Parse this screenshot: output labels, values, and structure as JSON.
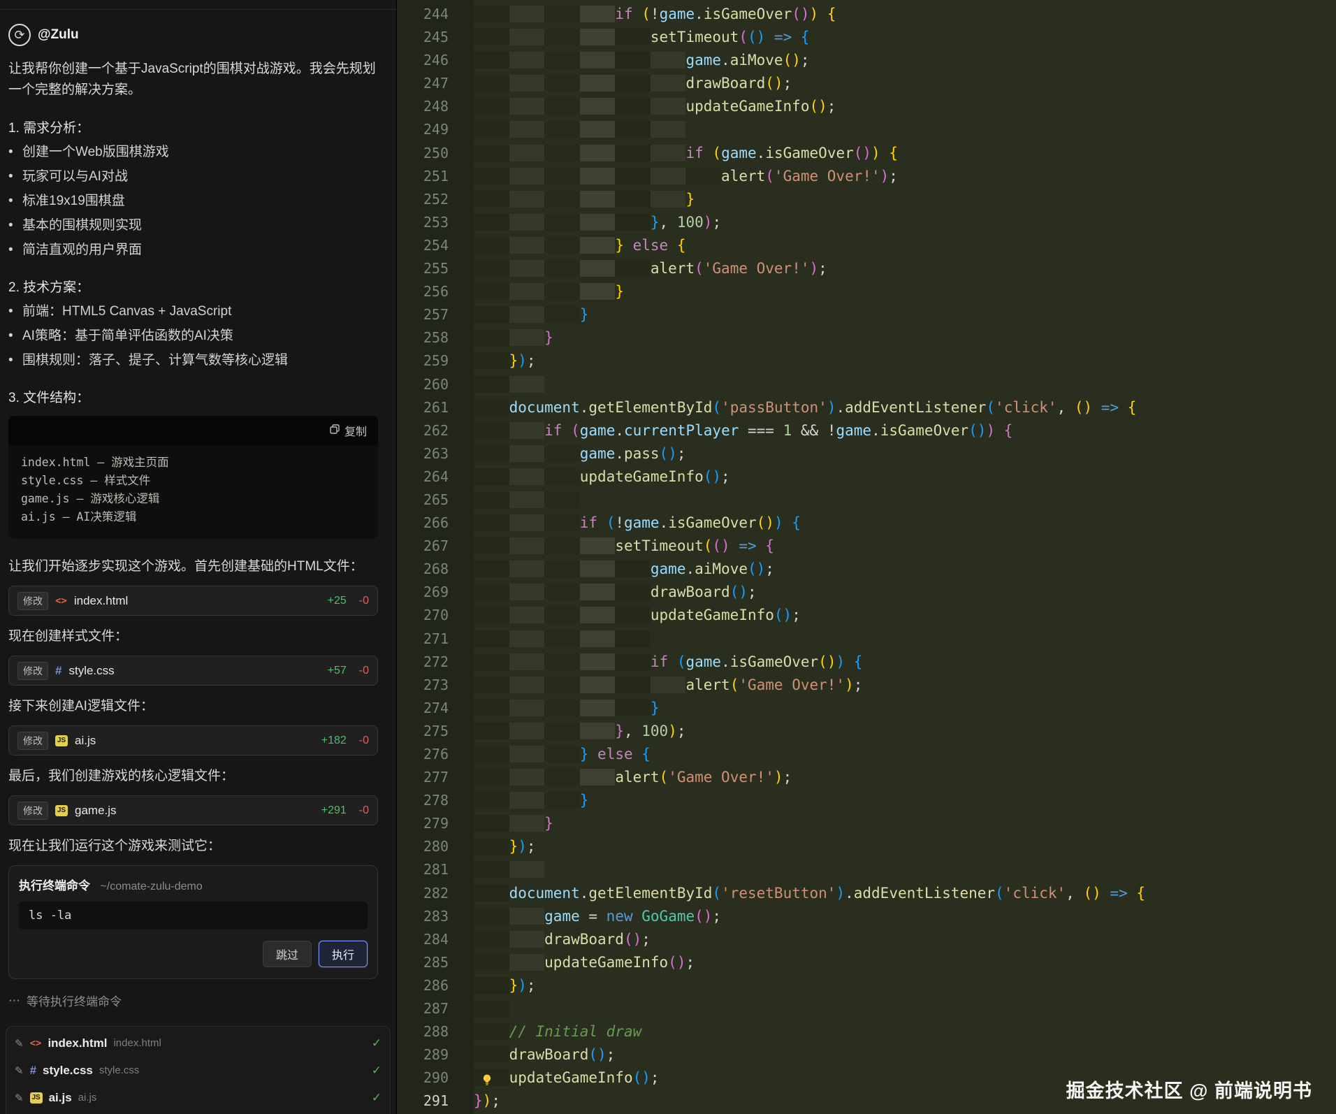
{
  "watermark": "掘金技术社区 @ 前端说明书",
  "assistant": {
    "name": "@Zulu",
    "intro": "让我帮你创建一个基于JavaScript的围棋对战游戏。我会先规划一个完整的解决方案。",
    "sections": [
      {
        "heading": "1. 需求分析：",
        "bullets": [
          "创建一个Web版围棋游戏",
          "玩家可以与AI对战",
          "标准19x19围棋盘",
          "基本的围棋规则实现",
          "简洁直观的用户界面"
        ]
      },
      {
        "heading": "2. 技术方案：",
        "bullets": [
          "前端：HTML5 Canvas + JavaScript",
          "AI策略：基于简单评估函数的AI决策",
          "围棋规则：落子、提子、计算气数等核心逻辑"
        ]
      },
      {
        "heading": "3. 文件结构：",
        "bullets": []
      }
    ],
    "code_block": {
      "copy_label": "复制",
      "lines": [
        "index.html — 游戏主页面",
        "style.css — 样式文件",
        "game.js — 游戏核心逻辑",
        "ai.js — AI决策逻辑"
      ]
    },
    "steps": [
      {
        "text": "让我们开始逐步实现这个游戏。首先创建基础的HTML文件：",
        "card": {
          "badge": "修改",
          "file": "index.html",
          "type": "html",
          "added": "+25",
          "removed": "-0"
        }
      },
      {
        "text": "现在创建样式文件：",
        "card": {
          "badge": "修改",
          "file": "style.css",
          "type": "css",
          "added": "+57",
          "removed": "-0"
        }
      },
      {
        "text": "接下来创建AI逻辑文件：",
        "card": {
          "badge": "修改",
          "file": "ai.js",
          "type": "js",
          "added": "+182",
          "removed": "-0"
        }
      },
      {
        "text": "最后，我们创建游戏的核心逻辑文件：",
        "card": {
          "badge": "修改",
          "file": "game.js",
          "type": "js",
          "added": "+291",
          "removed": "-0"
        }
      },
      {
        "text": "现在让我们运行这个游戏来测试它：",
        "card": null
      }
    ],
    "terminal": {
      "title": "执行终端命令",
      "path": "~/comate-zulu-demo",
      "command": "ls -la",
      "skip_label": "跳过",
      "run_label": "执行"
    },
    "waiting": "等待执行终端命令",
    "files": [
      {
        "name": "index.html",
        "path": "index.html",
        "type": "html"
      },
      {
        "name": "style.css",
        "path": "style.css",
        "type": "css"
      },
      {
        "name": "ai.js",
        "path": "ai.js",
        "type": "js"
      }
    ]
  },
  "editor": {
    "lines": [
      {
        "n": 244,
        "i": 16,
        "t": [
          [
            "if",
            "k"
          ],
          [
            " ",
            ""
          ],
          [
            "(",
            "b0"
          ],
          [
            "!",
            "o"
          ],
          [
            "game",
            "v"
          ],
          [
            ".",
            "o"
          ],
          [
            "isGameOver",
            "f"
          ],
          [
            "()",
            "b1"
          ],
          [
            ")",
            "b0"
          ],
          [
            " ",
            ""
          ],
          [
            "{",
            "b0"
          ]
        ]
      },
      {
        "n": 245,
        "i": 20,
        "t": [
          [
            "setTimeout",
            "f"
          ],
          [
            "(",
            "b1"
          ],
          [
            "()",
            "b2"
          ],
          [
            " => ",
            "a"
          ],
          [
            "{",
            "b2"
          ]
        ]
      },
      {
        "n": 246,
        "i": 24,
        "t": [
          [
            "game",
            "v"
          ],
          [
            ".",
            "o"
          ],
          [
            "aiMove",
            "f"
          ],
          [
            "()",
            "b0"
          ],
          [
            ";",
            "o"
          ]
        ]
      },
      {
        "n": 247,
        "i": 24,
        "t": [
          [
            "drawBoard",
            "f"
          ],
          [
            "()",
            "b0"
          ],
          [
            ";",
            "o"
          ]
        ]
      },
      {
        "n": 248,
        "i": 24,
        "t": [
          [
            "updateGameInfo",
            "f"
          ],
          [
            "()",
            "b0"
          ],
          [
            ";",
            "o"
          ]
        ]
      },
      {
        "n": 249,
        "i": 24,
        "t": []
      },
      {
        "n": 250,
        "i": 24,
        "t": [
          [
            "if",
            "k"
          ],
          [
            " ",
            ""
          ],
          [
            "(",
            "b0"
          ],
          [
            "game",
            "v"
          ],
          [
            ".",
            "o"
          ],
          [
            "isGameOver",
            "f"
          ],
          [
            "()",
            "b1"
          ],
          [
            ")",
            "b0"
          ],
          [
            " ",
            ""
          ],
          [
            "{",
            "b0"
          ]
        ]
      },
      {
        "n": 251,
        "i": 28,
        "t": [
          [
            "alert",
            "f"
          ],
          [
            "(",
            "b1"
          ],
          [
            "'Game Over!'",
            "s"
          ],
          [
            ")",
            "b1"
          ],
          [
            ";",
            "o"
          ]
        ]
      },
      {
        "n": 252,
        "i": 24,
        "t": [
          [
            "}",
            "b0"
          ]
        ]
      },
      {
        "n": 253,
        "i": 20,
        "t": [
          [
            "}",
            "b2"
          ],
          [
            ", ",
            "o"
          ],
          [
            "100",
            "n"
          ],
          [
            ")",
            "b1"
          ],
          [
            ";",
            "o"
          ]
        ]
      },
      {
        "n": 254,
        "i": 16,
        "t": [
          [
            "}",
            "b0"
          ],
          [
            " ",
            ""
          ],
          [
            "else",
            "k"
          ],
          [
            " ",
            ""
          ],
          [
            "{",
            "b0"
          ]
        ]
      },
      {
        "n": 255,
        "i": 20,
        "t": [
          [
            "alert",
            "f"
          ],
          [
            "(",
            "b1"
          ],
          [
            "'Game Over!'",
            "s"
          ],
          [
            ")",
            "b1"
          ],
          [
            ";",
            "o"
          ]
        ]
      },
      {
        "n": 256,
        "i": 16,
        "t": [
          [
            "}",
            "b0"
          ]
        ]
      },
      {
        "n": 257,
        "i": 12,
        "t": [
          [
            "}",
            "b2"
          ]
        ]
      },
      {
        "n": 258,
        "i": 8,
        "t": [
          [
            "}",
            "b1"
          ]
        ]
      },
      {
        "n": 259,
        "i": 4,
        "t": [
          [
            "}",
            "b0"
          ],
          [
            ")",
            "b2"
          ],
          [
            ";",
            "o"
          ]
        ]
      },
      {
        "n": 260,
        "i": 8,
        "t": []
      },
      {
        "n": 261,
        "i": 4,
        "t": [
          [
            "document",
            "v"
          ],
          [
            ".",
            "o"
          ],
          [
            "getElementById",
            "f"
          ],
          [
            "(",
            "b2"
          ],
          [
            "'passButton'",
            "s"
          ],
          [
            ")",
            "b2"
          ],
          [
            ".",
            "o"
          ],
          [
            "addEventListener",
            "f"
          ],
          [
            "(",
            "b2"
          ],
          [
            "'click'",
            "s"
          ],
          [
            ", ",
            "o"
          ],
          [
            "()",
            "b0"
          ],
          [
            " => ",
            "a"
          ],
          [
            "{",
            "b0"
          ]
        ]
      },
      {
        "n": 262,
        "i": 8,
        "t": [
          [
            "if",
            "k"
          ],
          [
            " ",
            ""
          ],
          [
            "(",
            "b1"
          ],
          [
            "game",
            "v"
          ],
          [
            ".",
            "o"
          ],
          [
            "currentPlayer",
            "v"
          ],
          [
            " === ",
            "o"
          ],
          [
            "1",
            "n"
          ],
          [
            " && ",
            "o"
          ],
          [
            "!",
            "o"
          ],
          [
            "game",
            "v"
          ],
          [
            ".",
            "o"
          ],
          [
            "isGameOver",
            "f"
          ],
          [
            "()",
            "b2"
          ],
          [
            ")",
            "b1"
          ],
          [
            " ",
            ""
          ],
          [
            "{",
            "b1"
          ]
        ]
      },
      {
        "n": 263,
        "i": 12,
        "t": [
          [
            "game",
            "v"
          ],
          [
            ".",
            "o"
          ],
          [
            "pass",
            "f"
          ],
          [
            "()",
            "b2"
          ],
          [
            ";",
            "o"
          ]
        ]
      },
      {
        "n": 264,
        "i": 12,
        "t": [
          [
            "updateGameInfo",
            "f"
          ],
          [
            "()",
            "b2"
          ],
          [
            ";",
            "o"
          ]
        ]
      },
      {
        "n": 265,
        "i": 12,
        "t": []
      },
      {
        "n": 266,
        "i": 12,
        "t": [
          [
            "if",
            "k"
          ],
          [
            " ",
            ""
          ],
          [
            "(",
            "b2"
          ],
          [
            "!",
            "o"
          ],
          [
            "game",
            "v"
          ],
          [
            ".",
            "o"
          ],
          [
            "isGameOver",
            "f"
          ],
          [
            "()",
            "b0"
          ],
          [
            ")",
            "b2"
          ],
          [
            " ",
            ""
          ],
          [
            "{",
            "b2"
          ]
        ]
      },
      {
        "n": 267,
        "i": 16,
        "t": [
          [
            "setTimeout",
            "f"
          ],
          [
            "(",
            "b0"
          ],
          [
            "()",
            "b1"
          ],
          [
            " => ",
            "a"
          ],
          [
            "{",
            "b1"
          ]
        ]
      },
      {
        "n": 268,
        "i": 20,
        "t": [
          [
            "game",
            "v"
          ],
          [
            ".",
            "o"
          ],
          [
            "aiMove",
            "f"
          ],
          [
            "()",
            "b2"
          ],
          [
            ";",
            "o"
          ]
        ]
      },
      {
        "n": 269,
        "i": 20,
        "t": [
          [
            "drawBoard",
            "f"
          ],
          [
            "()",
            "b2"
          ],
          [
            ";",
            "o"
          ]
        ]
      },
      {
        "n": 270,
        "i": 20,
        "t": [
          [
            "updateGameInfo",
            "f"
          ],
          [
            "()",
            "b2"
          ],
          [
            ";",
            "o"
          ]
        ]
      },
      {
        "n": 271,
        "i": 20,
        "t": []
      },
      {
        "n": 272,
        "i": 20,
        "t": [
          [
            "if",
            "k"
          ],
          [
            " ",
            ""
          ],
          [
            "(",
            "b2"
          ],
          [
            "game",
            "v"
          ],
          [
            ".",
            "o"
          ],
          [
            "isGameOver",
            "f"
          ],
          [
            "()",
            "b0"
          ],
          [
            ")",
            "b2"
          ],
          [
            " ",
            ""
          ],
          [
            "{",
            "b2"
          ]
        ]
      },
      {
        "n": 273,
        "i": 24,
        "t": [
          [
            "alert",
            "f"
          ],
          [
            "(",
            "b0"
          ],
          [
            "'Game Over!'",
            "s"
          ],
          [
            ")",
            "b0"
          ],
          [
            ";",
            "o"
          ]
        ]
      },
      {
        "n": 274,
        "i": 20,
        "t": [
          [
            "}",
            "b2"
          ]
        ]
      },
      {
        "n": 275,
        "i": 16,
        "t": [
          [
            "}",
            "b1"
          ],
          [
            ", ",
            "o"
          ],
          [
            "100",
            "n"
          ],
          [
            ")",
            "b0"
          ],
          [
            ";",
            "o"
          ]
        ]
      },
      {
        "n": 276,
        "i": 12,
        "t": [
          [
            "}",
            "b2"
          ],
          [
            " ",
            ""
          ],
          [
            "else",
            "k"
          ],
          [
            " ",
            ""
          ],
          [
            "{",
            "b2"
          ]
        ]
      },
      {
        "n": 277,
        "i": 16,
        "t": [
          [
            "alert",
            "f"
          ],
          [
            "(",
            "b0"
          ],
          [
            "'Game Over!'",
            "s"
          ],
          [
            ")",
            "b0"
          ],
          [
            ";",
            "o"
          ]
        ]
      },
      {
        "n": 278,
        "i": 12,
        "t": [
          [
            "}",
            "b2"
          ]
        ]
      },
      {
        "n": 279,
        "i": 8,
        "t": [
          [
            "}",
            "b1"
          ]
        ]
      },
      {
        "n": 280,
        "i": 4,
        "t": [
          [
            "}",
            "b0"
          ],
          [
            ")",
            "b2"
          ],
          [
            ";",
            "o"
          ]
        ]
      },
      {
        "n": 281,
        "i": 8,
        "t": []
      },
      {
        "n": 282,
        "i": 4,
        "t": [
          [
            "document",
            "v"
          ],
          [
            ".",
            "o"
          ],
          [
            "getElementById",
            "f"
          ],
          [
            "(",
            "b2"
          ],
          [
            "'resetButton'",
            "s"
          ],
          [
            ")",
            "b2"
          ],
          [
            ".",
            "o"
          ],
          [
            "addEventListener",
            "f"
          ],
          [
            "(",
            "b2"
          ],
          [
            "'click'",
            "s"
          ],
          [
            ", ",
            "o"
          ],
          [
            "()",
            "b0"
          ],
          [
            " => ",
            "a"
          ],
          [
            "{",
            "b0"
          ]
        ]
      },
      {
        "n": 283,
        "i": 8,
        "t": [
          [
            "game",
            "v"
          ],
          [
            " = ",
            "o"
          ],
          [
            "new",
            "a"
          ],
          [
            " ",
            ""
          ],
          [
            "GoGame",
            "t"
          ],
          [
            "()",
            "b1"
          ],
          [
            ";",
            "o"
          ]
        ]
      },
      {
        "n": 284,
        "i": 8,
        "t": [
          [
            "drawBoard",
            "f"
          ],
          [
            "()",
            "b1"
          ],
          [
            ";",
            "o"
          ]
        ]
      },
      {
        "n": 285,
        "i": 8,
        "t": [
          [
            "updateGameInfo",
            "f"
          ],
          [
            "()",
            "b1"
          ],
          [
            ";",
            "o"
          ]
        ]
      },
      {
        "n": 286,
        "i": 4,
        "t": [
          [
            "}",
            "b0"
          ],
          [
            ")",
            "b2"
          ],
          [
            ";",
            "o"
          ]
        ]
      },
      {
        "n": 287,
        "i": 4,
        "t": []
      },
      {
        "n": 288,
        "i": 4,
        "t": [
          [
            "// Initial draw",
            "c"
          ]
        ]
      },
      {
        "n": 289,
        "i": 4,
        "t": [
          [
            "drawBoard",
            "f"
          ],
          [
            "()",
            "b2"
          ],
          [
            ";",
            "o"
          ]
        ]
      },
      {
        "n": 290,
        "i": 4,
        "bulb": true,
        "t": [
          [
            "updateGameInfo",
            "f"
          ],
          [
            "()",
            "b2"
          ],
          [
            ";",
            "o"
          ]
        ]
      },
      {
        "n": 291,
        "i": 0,
        "active": true,
        "t": [
          [
            "}",
            "b1"
          ],
          [
            ")",
            "b0"
          ],
          [
            ";",
            "o"
          ]
        ]
      }
    ]
  }
}
